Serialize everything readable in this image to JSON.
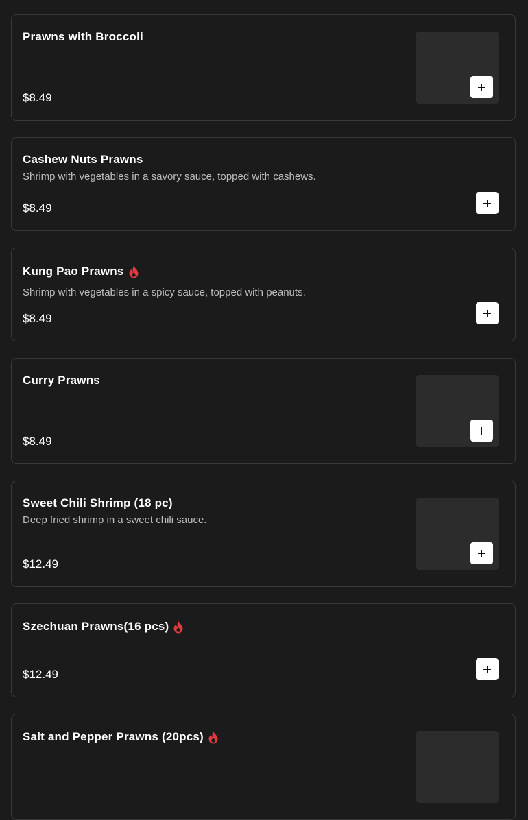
{
  "colors": {
    "background": "#1b1b1b",
    "card_border": "#3a3a3a",
    "spicy_icon": "#e0393e",
    "button": "#ffffff"
  },
  "menu_items": [
    {
      "name": "Prawns with Broccoli",
      "description": "",
      "price": "$8.49",
      "spicy": false,
      "has_image": true
    },
    {
      "name": "Cashew Nuts Prawns",
      "description": "Shrimp with vegetables in a savory sauce, topped with cashews.",
      "price": "$8.49",
      "spicy": false,
      "has_image": false
    },
    {
      "name": "Kung Pao Prawns",
      "description": "Shrimp with vegetables in a spicy sauce, topped with peanuts.",
      "price": "$8.49",
      "spicy": true,
      "has_image": false
    },
    {
      "name": "Curry Prawns",
      "description": "",
      "price": "$8.49",
      "spicy": false,
      "has_image": true
    },
    {
      "name": "Sweet Chili Shrimp (18 pc)",
      "description": "Deep fried shrimp in a sweet chili sauce.",
      "price": "$12.49",
      "spicy": false,
      "has_image": true
    },
    {
      "name": "Szechuan Prawns(16 pcs)",
      "description": "",
      "price": "$12.49",
      "spicy": true,
      "has_image": false
    },
    {
      "name": "Salt and Pepper Prawns (20pcs)",
      "description": "",
      "price": "",
      "spicy": true,
      "has_image": true
    }
  ]
}
